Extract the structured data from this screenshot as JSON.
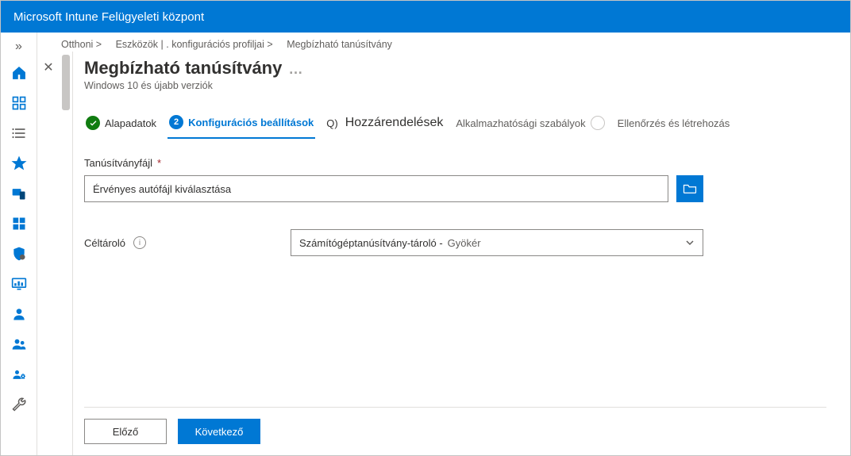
{
  "app": {
    "title": "Microsoft Intune Felügyeleti központ"
  },
  "breadcrumb": {
    "items": [
      {
        "label": "Otthoni >"
      },
      {
        "label": "Eszközök | . konfigurációs profiljai >"
      },
      {
        "label": "Megbízható tanúsítvány"
      }
    ]
  },
  "page": {
    "title": "Megbízható tanúsítvány",
    "subtitle": "Windows 10 és újabb verziók"
  },
  "wizard": {
    "steps": [
      {
        "label": "Alapadatok"
      },
      {
        "badge": "2",
        "label": "Konfigurációs beállítások"
      },
      {
        "prefix": "Q)",
        "label": "Hozzárendelések"
      },
      {
        "label": "Alkalmazhatósági szabályok"
      },
      {
        "label": "Ellenőrzés és létrehozás"
      }
    ]
  },
  "form": {
    "cert_label": "Tanúsítványfájl",
    "cert_value": "Érvényes autófájl kiválasztása",
    "dest_label": "Céltároló",
    "dest_value_main": "Számítógéptanúsítvány-tároló -",
    "dest_value_sub": "Gyökér"
  },
  "footer": {
    "prev": "Előző",
    "next": "Következő"
  }
}
